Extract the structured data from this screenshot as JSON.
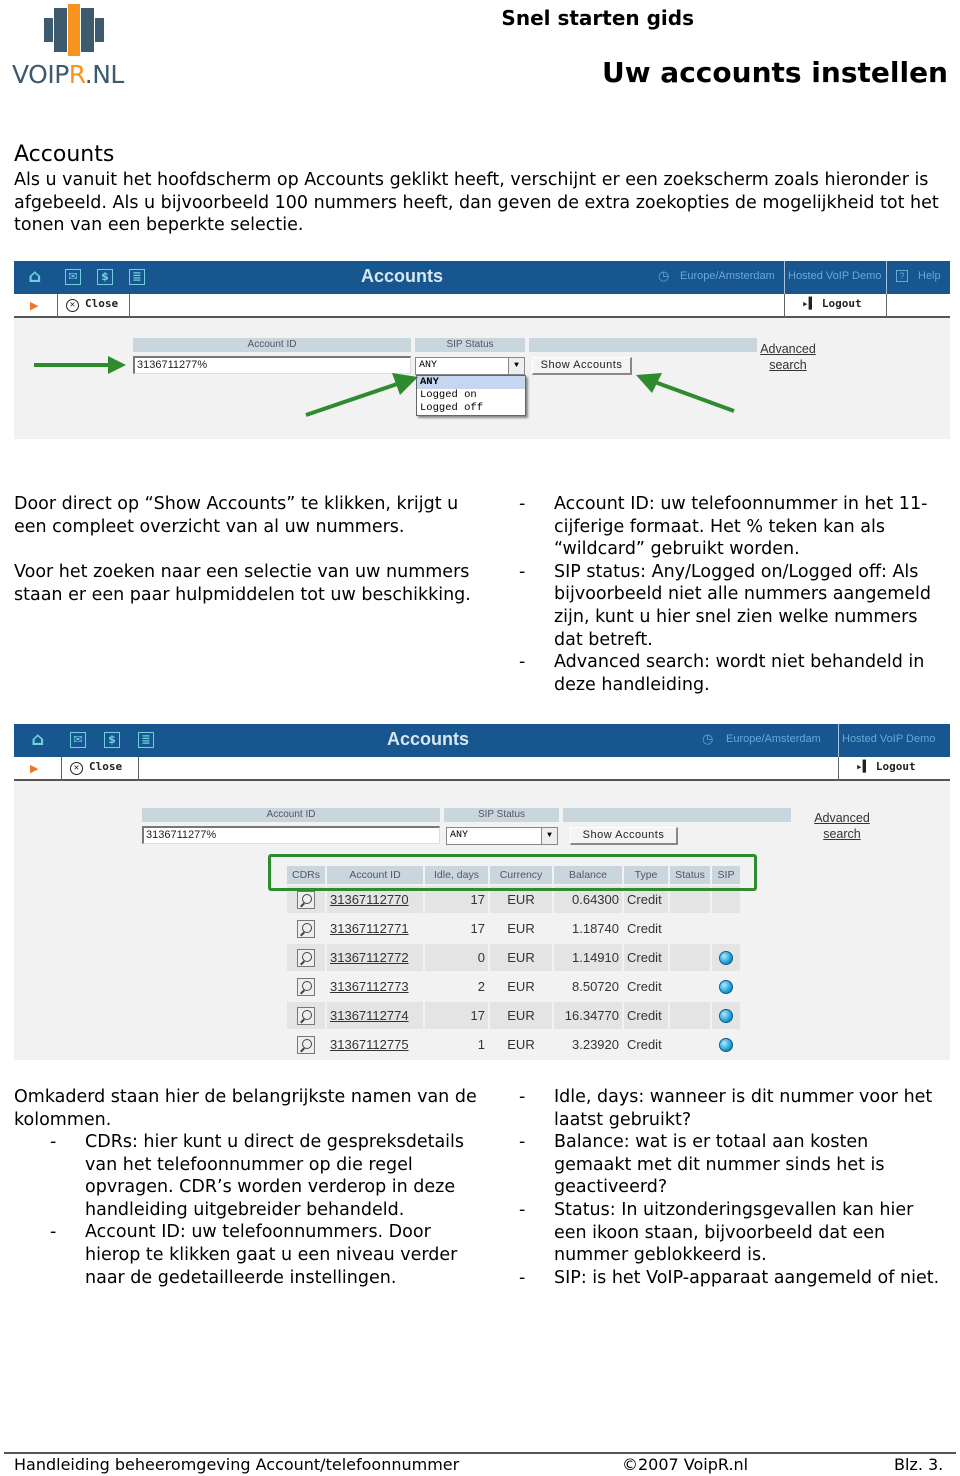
{
  "header": {
    "logo_text_a": "VOIP",
    "logo_text_r": "R",
    "logo_text_b": ".NL",
    "subtitle": "Snel starten gids",
    "title": "Uw accounts instellen"
  },
  "section": {
    "title": "Accounts",
    "intro": "Als u vanuit het hoofdscherm op Accounts geklikt heeft, verschijnt er een zoekscherm zoals hieronder is afgebeeld. Als u bijvoorbeeld 100 nummers heeft, dan geven de extra zoekopties de mogelijkheid tot het tonen van een beperkte selectie."
  },
  "app": {
    "page_title": "Accounts",
    "timezone": "Europe/Amsterdam",
    "environment": "Hosted VoIP Demo",
    "help_label": "Help",
    "close_label": "Close",
    "logout_label": "Logout",
    "account_id_label": "Account ID",
    "account_id_value": "3136711277%",
    "sip_status_label": "SIP Status",
    "sip_status_value": "ANY",
    "sip_status_options": [
      "ANY",
      "Logged on",
      "Logged off"
    ],
    "show_accounts_label": "Show Accounts",
    "advanced_search_line1": "Advanced",
    "advanced_search_line2": "search",
    "icons": {
      "home": "home-icon",
      "mail": "envelope-icon",
      "dollar": "dollar-icon",
      "list": "list-icon",
      "clock": "clock-icon",
      "help": "question-icon",
      "close": "close-circle-icon",
      "logout": "logout-door-icon"
    },
    "colors": {
      "topbar": "#17568f",
      "highlight_box": "#2e8b2e",
      "sip_online": "#1e9fd6"
    }
  },
  "middle": {
    "left_p1": "Door direct op “Show Accounts” te klikken, krijgt u een compleet overzicht van al uw nummers.",
    "left_p2": "Voor het zoeken naar een selectie van uw nummers staan er een paar hulpmiddelen tot uw beschikking.",
    "bullets": [
      "Account ID: uw telefoonnummer in het 11-cijferige formaat. Het % teken kan als “wildcard” gebruikt worden.",
      "SIP status: Any/Logged on/Logged off: Als bijvoorbeeld niet alle nummers aangemeld zijn, kunt u hier snel zien welke nummers dat betreft.",
      "Advanced search: wordt niet behandeld in deze handleiding."
    ]
  },
  "table": {
    "columns": [
      "CDRs",
      "Account ID",
      "Idle, days",
      "Currency",
      "Balance",
      "Type",
      "Status",
      "SIP"
    ],
    "rows": [
      {
        "account_id": "31367112770",
        "idle": "17",
        "currency": "EUR",
        "balance": "0.64300",
        "type": "Credit",
        "status": "",
        "sip_online": false
      },
      {
        "account_id": "31367112771",
        "idle": "17",
        "currency": "EUR",
        "balance": "1.18740",
        "type": "Credit",
        "status": "",
        "sip_online": false
      },
      {
        "account_id": "31367112772",
        "idle": "0",
        "currency": "EUR",
        "balance": "1.14910",
        "type": "Credit",
        "status": "",
        "sip_online": true
      },
      {
        "account_id": "31367112773",
        "idle": "2",
        "currency": "EUR",
        "balance": "8.50720",
        "type": "Credit",
        "status": "",
        "sip_online": true
      },
      {
        "account_id": "31367112774",
        "idle": "17",
        "currency": "EUR",
        "balance": "16.34770",
        "type": "Credit",
        "status": "",
        "sip_online": true
      },
      {
        "account_id": "31367112775",
        "idle": "1",
        "currency": "EUR",
        "balance": "3.23920",
        "type": "Credit",
        "status": "",
        "sip_online": true
      }
    ]
  },
  "lower": {
    "intro": "Omkaderd staan hier de belangrijkste namen van de kolommen.",
    "left_bullets": [
      "CDRs: hier kunt u direct de gespreksdetails van het telefoonnummer op die regel opvragen. CDR’s worden verderop in deze handleiding uitgebreider behandeld.",
      "Account ID: uw telefoonnummers. Door hierop te klikken gaat u een niveau verder naar de gedetailleerde instellingen."
    ],
    "right_bullets": [
      "Idle, days: wanneer is dit nummer voor het laatst gebruikt?",
      "Balance: wat is er totaal aan kosten gemaakt met dit nummer sinds het is geactiveerd?",
      "Status: In uitzonderingsgevallen kan hier een ikoon staan, bijvoorbeeld dat een nummer geblokkeerd is.",
      "SIP: is het VoIP-apparaat aangemeld of niet."
    ]
  },
  "footer": {
    "left": "Handleiding beheeromgeving Account/telefoonnummer",
    "center": "©2007 VoipR.nl",
    "right": "Blz. 3."
  },
  "bullet_dash": "-"
}
